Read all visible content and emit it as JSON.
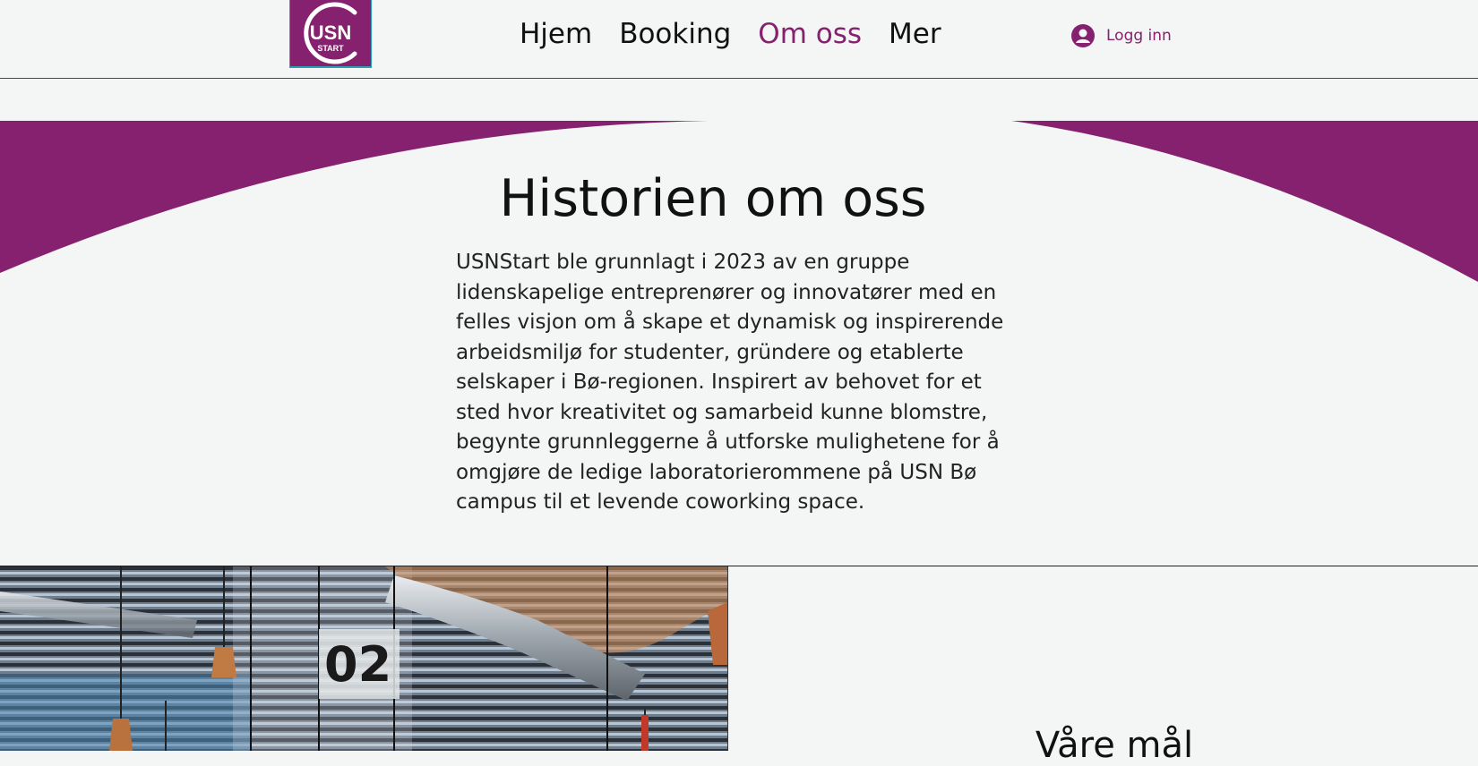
{
  "header": {
    "logo": {
      "line1": "USN",
      "line2": "START"
    },
    "nav": [
      {
        "label": "Hjem",
        "active": false
      },
      {
        "label": "Booking",
        "active": false
      },
      {
        "label": "Om oss",
        "active": true
      },
      {
        "label": "Mer",
        "active": false
      }
    ],
    "login_label": "Logg inn"
  },
  "hero": {
    "title": "Historien om oss",
    "story": "USNStart ble grunnlagt i 2023 av en gruppe lidenskapelige entreprenører og innovatører med en felles visjon om å skape et dynamisk og inspirerende arbeidsmiljø for studenter, gründere og etablerte selskaper i Bø-regionen. Inspirert av behovet for et sted hvor kreativitet og samarbeid kunne blomstre, begynte grunnleggerne å utforske mulighetene for å omgjøre de ledige laboratorierommene på USN Bø campus til et levende coworking space."
  },
  "photo": {
    "sign_text": "02"
  },
  "goals": {
    "title": "Våre mål"
  },
  "colors": {
    "brand": "#85216e",
    "background": "#f3f6f4",
    "logo_border": "#2aa0b5"
  }
}
